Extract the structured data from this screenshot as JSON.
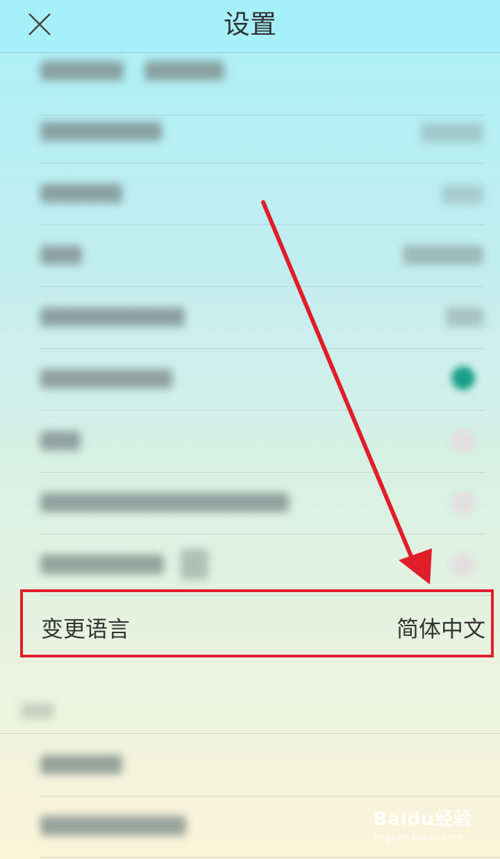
{
  "header": {
    "title": "设置",
    "close_icon": "close-icon"
  },
  "language_row": {
    "label": "变更语言",
    "value": "简体中文"
  },
  "watermark": {
    "brand": "Baidu经验",
    "url": "jingyan.baidu.com"
  },
  "colors": {
    "highlight_red": "#e11d2a",
    "header_bg": "#a6f0fa",
    "toggle_on": "#1a9e8c"
  }
}
